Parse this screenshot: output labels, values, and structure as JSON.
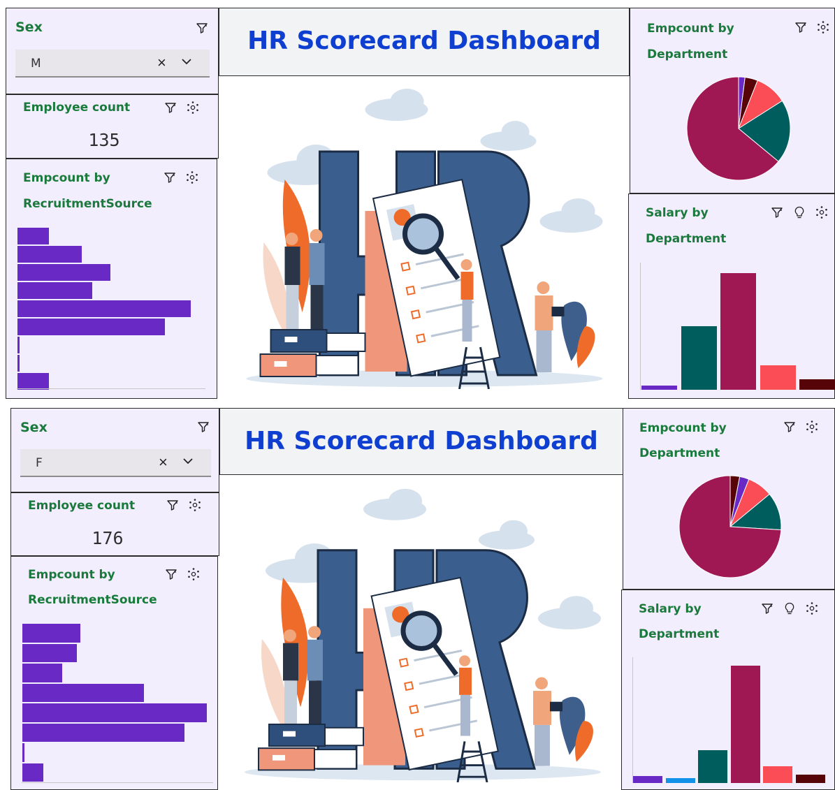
{
  "dashboards": [
    {
      "sex_filter": {
        "title": "Sex",
        "selected": "M"
      },
      "title": "HR Scorecard Dashboard",
      "employee_count": {
        "title": "Employee count",
        "value": "135"
      },
      "recruitment": {
        "title_line1": "Empcount by",
        "title_line2": "RecruitmentSource"
      },
      "emp_by_dept": {
        "title_line1": "Empcount by",
        "title_line2": "Department"
      },
      "salary_by_dept": {
        "title_line1": "Salary by",
        "title_line2": "Department"
      }
    },
    {
      "sex_filter": {
        "title": "Sex",
        "selected": "F"
      },
      "title": "HR Scorecard Dashboard",
      "employee_count": {
        "title": "Employee count",
        "value": "176"
      },
      "recruitment": {
        "title_line1": "Empcount by",
        "title_line2": "RecruitmentSource"
      },
      "emp_by_dept": {
        "title_line1": "Empcount by",
        "title_line2": "Department"
      },
      "salary_by_dept": {
        "title_line1": "Salary by",
        "title_line2": "Department"
      }
    }
  ],
  "icons": [
    "filter-icon",
    "settings-dots-icon",
    "lightbulb-icon",
    "close-icon",
    "chevron-down-icon"
  ],
  "colors": {
    "accent_green": "#1a7a3c",
    "title_blue": "#0f3fd1",
    "bar_purple": "#6929c4",
    "panel_bg": "#f3eefe",
    "dept_colors": [
      "#6929c4",
      "#1192e8",
      "#005d5d",
      "#9f1853",
      "#fa4d56",
      "#570408"
    ]
  },
  "chart_data": [
    {
      "type": "bar",
      "orientation": "horizontal",
      "dashboard": "M",
      "values": [
        9,
        18,
        26,
        21,
        48,
        41,
        1,
        1,
        9
      ]
    },
    {
      "type": "pie",
      "dashboard": "M",
      "series": [
        {
          "color": "#6929c4",
          "value": 2
        },
        {
          "color": "#570408",
          "value": 4
        },
        {
          "color": "#fa4d56",
          "value": 10
        },
        {
          "color": "#005d5d",
          "value": 20
        },
        {
          "color": "#9f1853",
          "value": 64
        }
      ]
    },
    {
      "type": "bar",
      "dashboard": "M",
      "values": [
        6,
        90,
        165,
        35,
        15
      ],
      "colors": [
        "#6929c4",
        "#005d5d",
        "#9f1853",
        "#fa4d56",
        "#570408"
      ]
    },
    {
      "type": "bar",
      "orientation": "horizontal",
      "dashboard": "F",
      "values": [
        16,
        15,
        11,
        33,
        50,
        44,
        1,
        6
      ]
    },
    {
      "type": "pie",
      "dashboard": "F",
      "series": [
        {
          "color": "#570408",
          "value": 3
        },
        {
          "color": "#6929c4",
          "value": 3
        },
        {
          "color": "#fa4d56",
          "value": 8
        },
        {
          "color": "#005d5d",
          "value": 12
        },
        {
          "color": "#9f1853",
          "value": 74
        }
      ]
    },
    {
      "type": "bar",
      "dashboard": "F",
      "values": [
        6,
        4,
        28,
        100,
        14,
        7
      ],
      "colors": [
        "#6929c4",
        "#1192e8",
        "#005d5d",
        "#9f1853",
        "#fa4d56",
        "#570408"
      ]
    }
  ]
}
